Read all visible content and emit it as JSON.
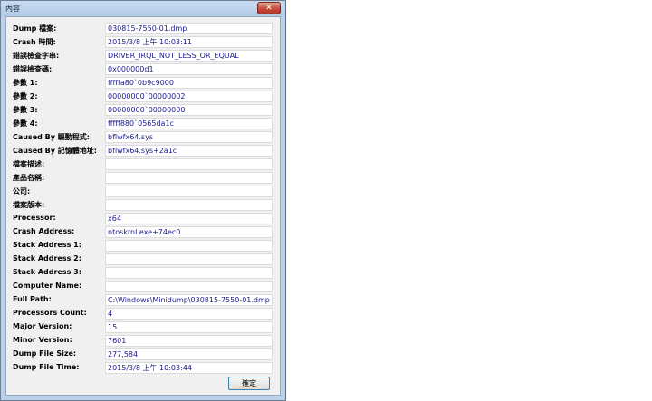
{
  "window": {
    "title": "內容",
    "close_glyph": "✕"
  },
  "properties": [
    {
      "label": "Dump 檔案:",
      "value": "030815-7550-01.dmp"
    },
    {
      "label": "Crash 時間:",
      "value": "2015/3/8 上午 10:03:11"
    },
    {
      "label": "錯誤檢查字串:",
      "value": "DRIVER_IRQL_NOT_LESS_OR_EQUAL"
    },
    {
      "label": "錯誤檢查碼:",
      "value": "0x000000d1"
    },
    {
      "label": "參數 1:",
      "value": "fffffa80`0b9c9000"
    },
    {
      "label": "參數 2:",
      "value": "00000000`00000002"
    },
    {
      "label": "參數 3:",
      "value": "00000000`00000000"
    },
    {
      "label": "參數 4:",
      "value": "fffff880`0565da1c"
    },
    {
      "label": "Caused By 驅動程式:",
      "value": "bflwfx64.sys"
    },
    {
      "label": "Caused By 記憶體地址:",
      "value": "bflwfx64.sys+2a1c"
    },
    {
      "label": "檔案描述:",
      "value": ""
    },
    {
      "label": "產品名稱:",
      "value": ""
    },
    {
      "label": "公司:",
      "value": ""
    },
    {
      "label": "檔案版本:",
      "value": ""
    },
    {
      "label": "Processor:",
      "value": "x64"
    },
    {
      "label": "Crash Address:",
      "value": "ntoskrnl.exe+74ec0"
    },
    {
      "label": "Stack Address 1:",
      "value": ""
    },
    {
      "label": "Stack Address 2:",
      "value": ""
    },
    {
      "label": "Stack Address 3:",
      "value": ""
    },
    {
      "label": "Computer Name:",
      "value": ""
    },
    {
      "label": "Full Path:",
      "value": "C:\\Windows\\Minidump\\030815-7550-01.dmp"
    },
    {
      "label": "Processors Count:",
      "value": "4"
    },
    {
      "label": "Major Version:",
      "value": "15"
    },
    {
      "label": "Minor Version:",
      "value": "7601"
    },
    {
      "label": "Dump File Size:",
      "value": "277,584"
    },
    {
      "label": "Dump File Time:",
      "value": "2015/3/8 上午 10:03:44"
    }
  ],
  "buttons": {
    "ok_label": "確定"
  }
}
